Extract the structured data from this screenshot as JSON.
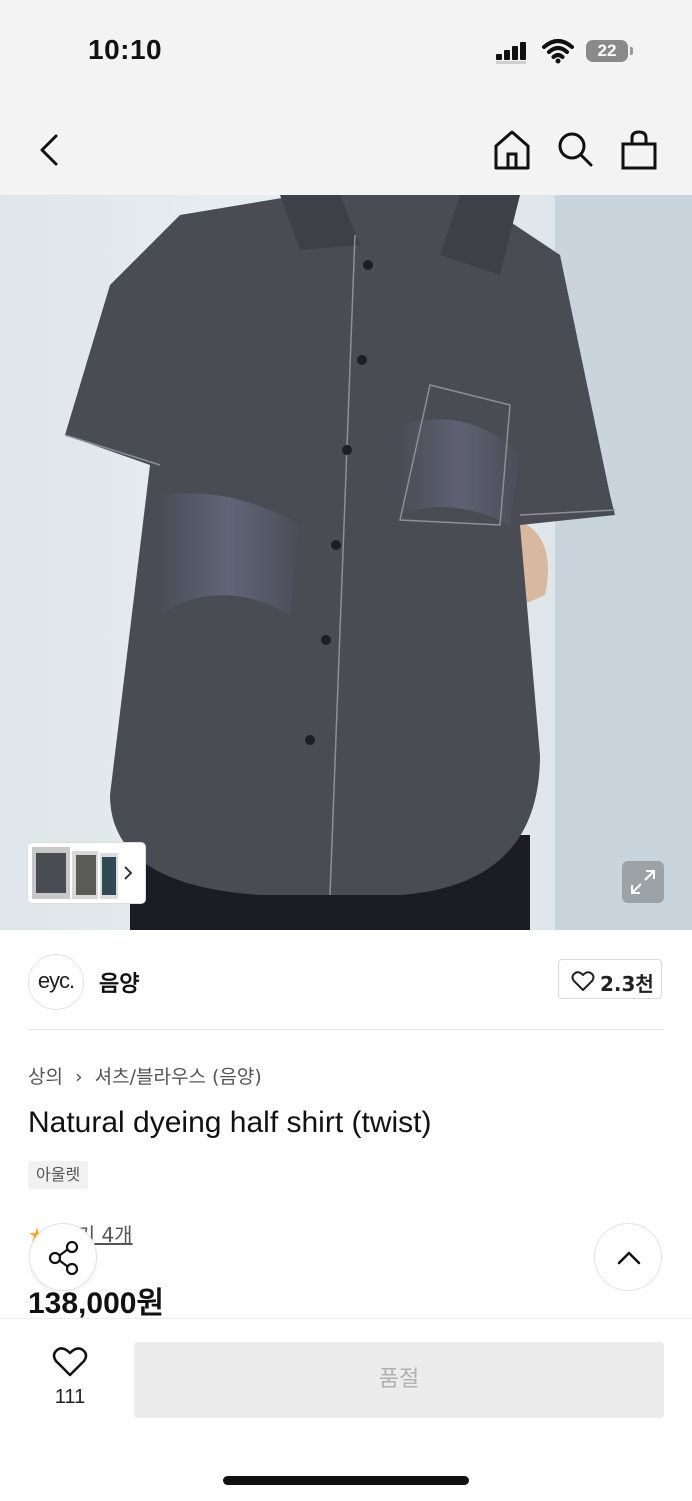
{
  "status": {
    "time": "10:10",
    "battery": "22"
  },
  "nav": {
    "back_icon": "chevron-left-icon",
    "home_icon": "home-icon",
    "search_icon": "search-icon",
    "bag_icon": "shopping-bag-icon"
  },
  "brand": {
    "logo_text": "eyc.",
    "name": "음양",
    "like_count": "2.3천"
  },
  "breadcrumb": [
    "상의",
    "셔츠/블라우스 (음양)"
  ],
  "product": {
    "title": "Natural dyeing half shirt (twist)",
    "tag": "아울렛",
    "review_text": "후기 4개",
    "price": "138,000원"
  },
  "bottom": {
    "wish_count": "111",
    "soldout_label": "품절"
  },
  "colors": {
    "accent_star": "#f5a623",
    "soldout_bg": "#ececec",
    "soldout_text": "#b0b0b0"
  }
}
